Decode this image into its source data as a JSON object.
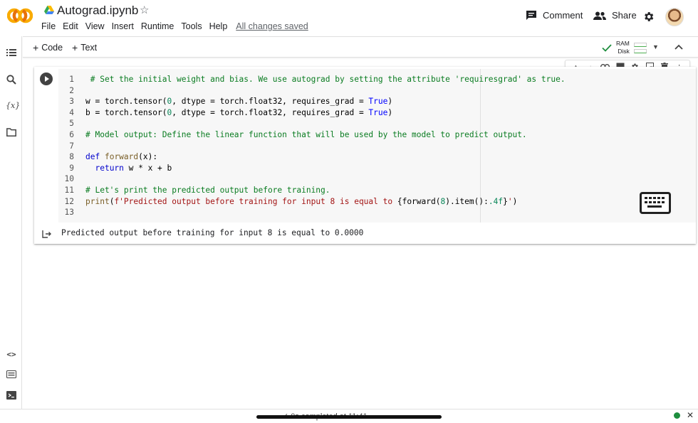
{
  "header": {
    "logo": "CO",
    "title": "Autograd.ipynb",
    "star": "☆",
    "menu": [
      "File",
      "Edit",
      "View",
      "Insert",
      "Runtime",
      "Tools",
      "Help"
    ],
    "save_status": "All changes saved",
    "comment_label": "Comment",
    "share_label": "Share"
  },
  "toolbar": {
    "add_code": "Code",
    "add_text": "Text",
    "ram_label": "RAM",
    "disk_label": "Disk"
  },
  "cell": {
    "line_numbers": [
      "1",
      "2",
      "3",
      "4",
      "5",
      "6",
      "7",
      "8",
      "9",
      "10",
      "11",
      "12",
      "13"
    ],
    "output": "Predicted output before training for input 8 is equal to 0.0000"
  },
  "status": {
    "text": "✓ 0s   completed at 11:41"
  },
  "colors": {
    "brand_orange": "#f9ab00",
    "code_comment": "#0a7c21",
    "code_keyword": "#0000cc",
    "status_green": "#1e8e3e"
  }
}
